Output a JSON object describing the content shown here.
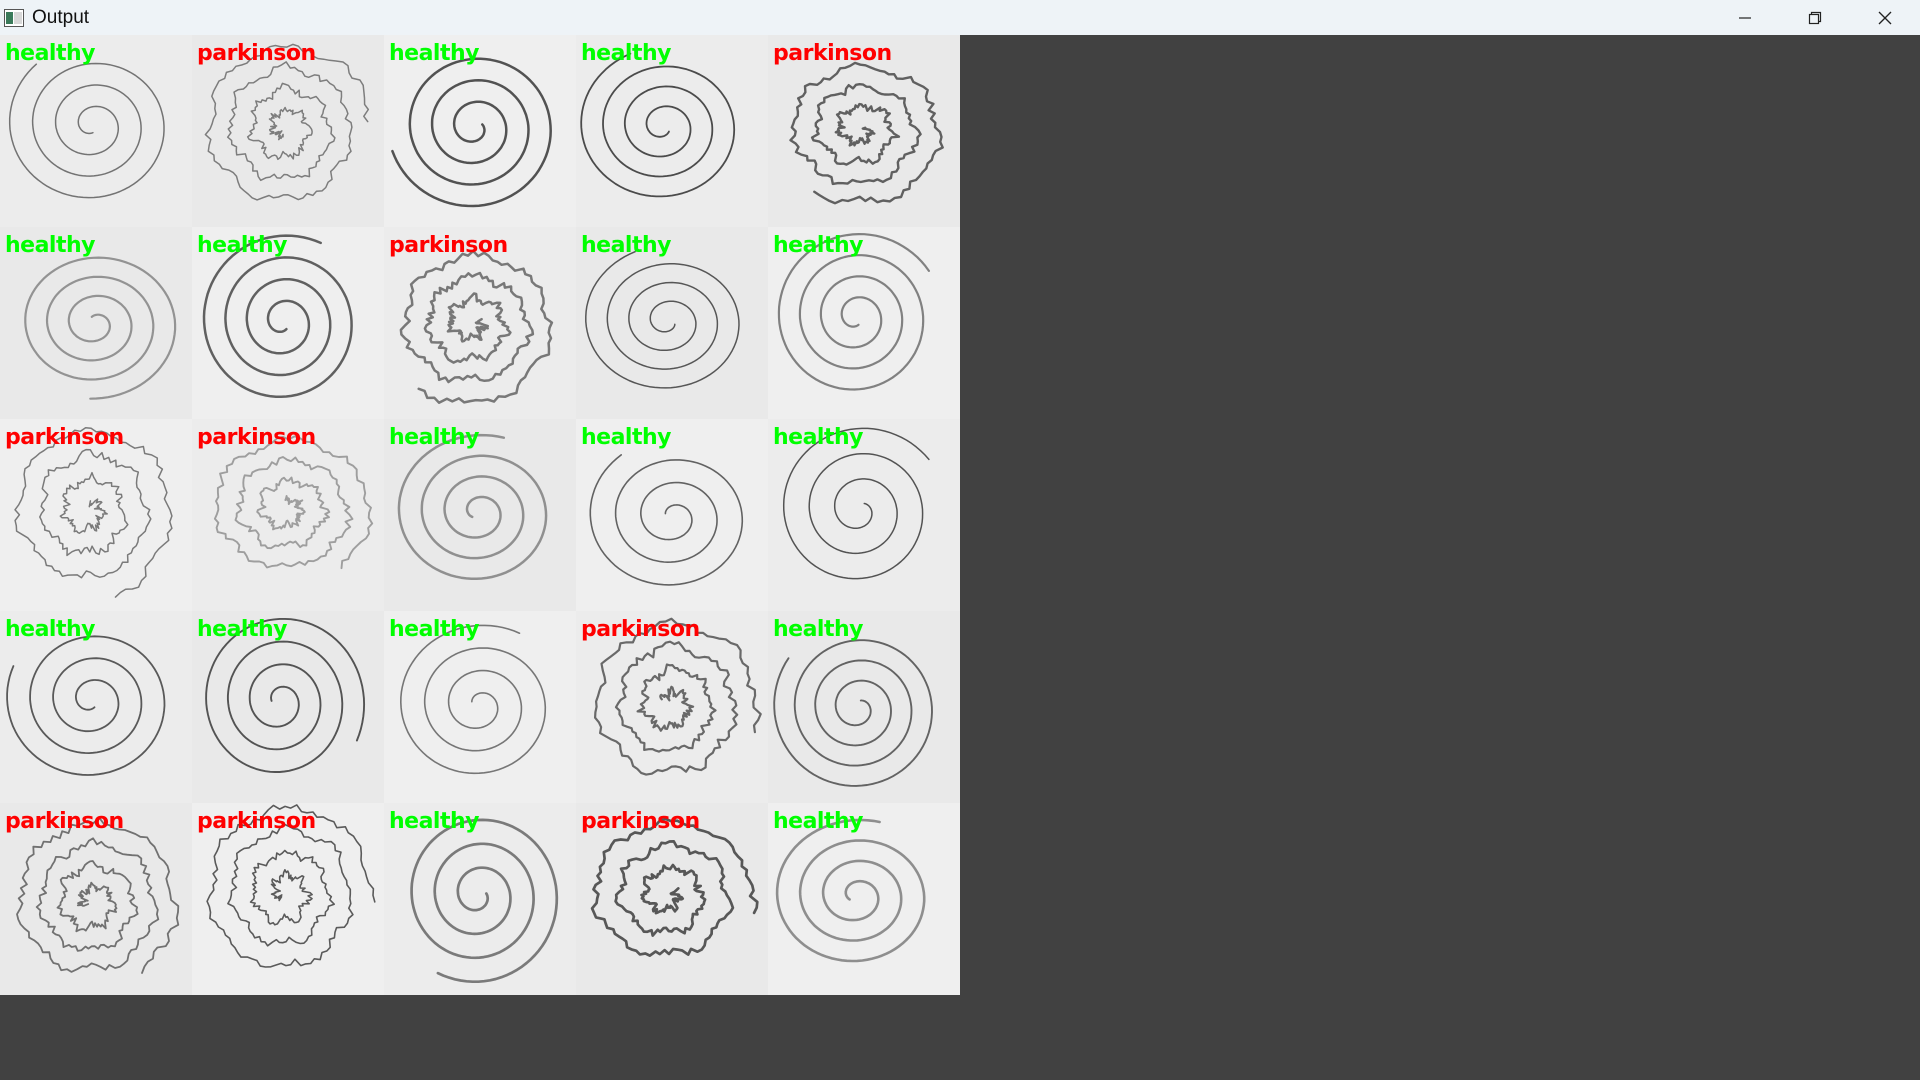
{
  "window": {
    "title": "Output"
  },
  "icons": {
    "app": "opencv-window-icon",
    "minimize": "minimize-icon",
    "restore": "restore-icon",
    "close": "close-icon"
  },
  "colors": {
    "healthy": "#00ff00",
    "parkinson": "#ff0000",
    "background": "#414141"
  },
  "grid": {
    "rows": [
      [
        "healthy",
        "parkinson",
        "healthy",
        "healthy",
        "parkinson"
      ],
      [
        "healthy",
        "healthy",
        "parkinson",
        "healthy",
        "healthy"
      ],
      [
        "parkinson",
        "parkinson",
        "healthy",
        "healthy",
        "healthy"
      ],
      [
        "healthy",
        "healthy",
        "healthy",
        "parkinson",
        "healthy"
      ],
      [
        "parkinson",
        "parkinson",
        "healthy",
        "parkinson",
        "healthy"
      ]
    ]
  }
}
